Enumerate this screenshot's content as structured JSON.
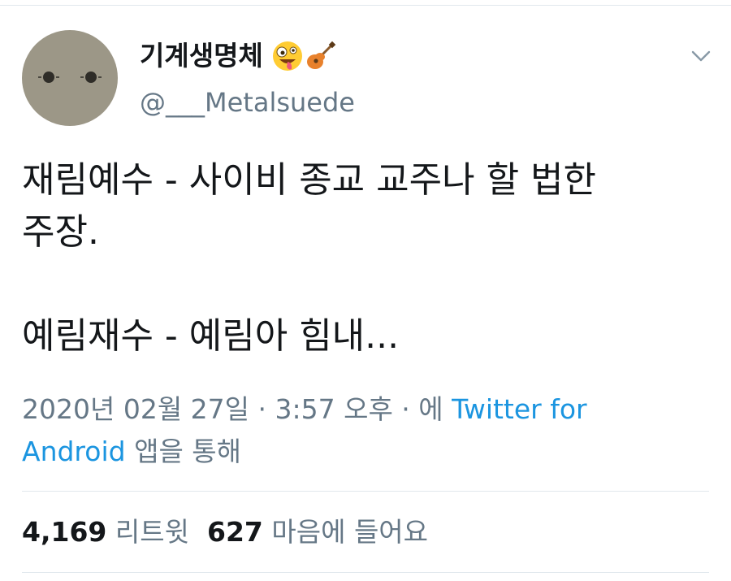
{
  "author": {
    "display_name": "기계생명체",
    "username": "@___Metalsuede",
    "name_emojis": [
      "zany-face-icon",
      "guitar-icon"
    ]
  },
  "tweet": {
    "line1": "재림예수 - 사이비 종교 교주나 할 법한",
    "line2": "주장.",
    "line3": "예림재수 - 예림아 힘내..."
  },
  "meta": {
    "datetime": "2020년 02월 27일 · 3:57 오후 · 에 ",
    "source_part1": "Twitter for",
    "source_part2": "Android",
    "suffix": " 앱을 통해"
  },
  "stats": {
    "retweets_count": "4,169",
    "retweets_label": "리트윗",
    "likes_count": "627",
    "likes_label": "마음에 들어요"
  },
  "colors": {
    "text": "#14171a",
    "secondary": "#657786",
    "link": "#1b95e0",
    "divider": "#e1e8ed"
  }
}
